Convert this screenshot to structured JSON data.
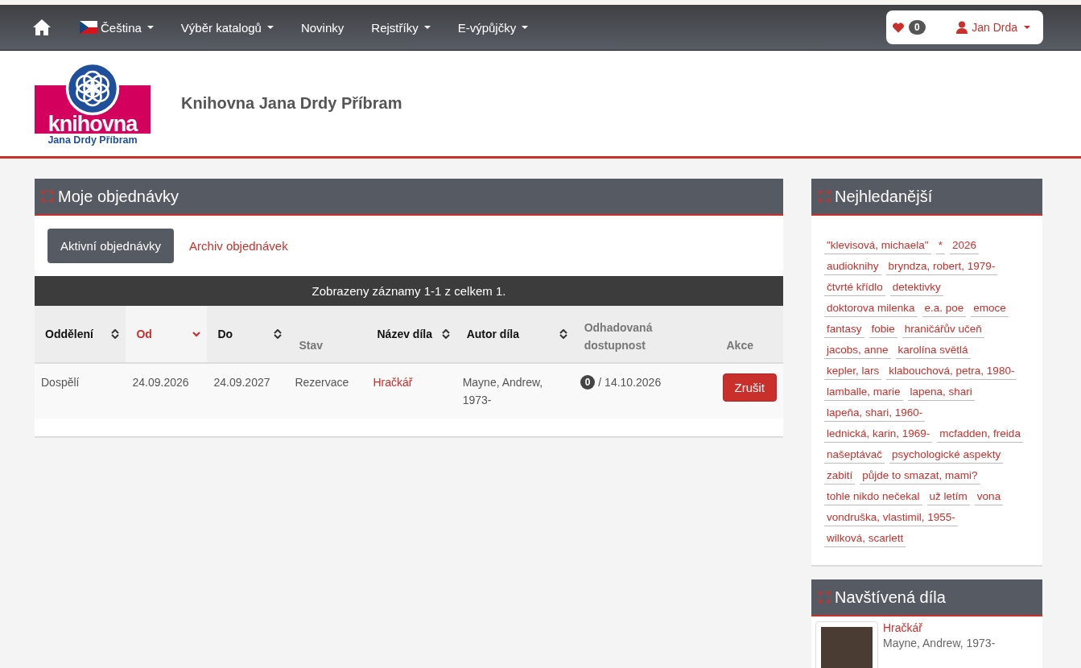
{
  "nav": {
    "items": [
      {
        "label": "Čeština",
        "flag": true,
        "dropdown": true
      },
      {
        "label": "Výběr katalogů",
        "flag": false,
        "dropdown": true
      },
      {
        "label": "Novinky",
        "flag": false,
        "dropdown": false
      },
      {
        "label": "Rejstříky",
        "flag": false,
        "dropdown": true
      },
      {
        "label": "E-výpůjčky",
        "flag": false,
        "dropdown": true
      }
    ],
    "favorites_count": "0",
    "user": "Jan Drda"
  },
  "header": {
    "logo_word": "knihovna",
    "logo_sub": "Jana Drdy Příbram",
    "title": "Knihovna Jana Drdy Příbram"
  },
  "orders": {
    "title": "Moje objednávky",
    "tabs": [
      {
        "label": "Aktivní objednávky",
        "selected": true
      },
      {
        "label": "Archiv objednávek",
        "selected": false
      }
    ],
    "summary": "Zobrazeny záznamy 1-1 z celkem 1.",
    "columns": [
      {
        "label": "Oddělení",
        "sortable": true,
        "selected": false
      },
      {
        "label": "Od",
        "sortable": true,
        "selected": true
      },
      {
        "label": "Do",
        "sortable": true,
        "selected": false
      },
      {
        "label": "Stav",
        "sortable": false,
        "selected": false
      },
      {
        "label": "Název díla",
        "sortable": true,
        "selected": false
      },
      {
        "label": "Autor díla",
        "sortable": true,
        "selected": false
      },
      {
        "label": "Odhadovaná dostupnost",
        "sortable": false,
        "selected": false
      },
      {
        "label": "Akce",
        "sortable": false,
        "selected": false
      }
    ],
    "rows": [
      {
        "department": "Dospělí",
        "from": "24.09.2026",
        "to": "24.09.2027",
        "status": "Rezervace",
        "title": "Hračkář",
        "author": "Mayne, Andrew, 1973-",
        "queue": "0",
        "available": "/ 14.10.2026",
        "action": "Zrušit"
      }
    ]
  },
  "most_searched": {
    "title": "Nejhledanější",
    "tags": [
      "\"klevisová, michaela\"",
      "*",
      "2026",
      "audioknihy",
      "bryndza, robert, 1979-",
      "čtvrté křídlo",
      "detektivky",
      "doktorova milenka",
      "e.a. poe",
      "emoce",
      "fantasy",
      "fobie",
      "hraničářův učeň",
      "jacobs, anne",
      "karolína světlá",
      "kepler, lars",
      "klabouchová, petra, 1980-",
      "lamballe, marie",
      "lapena, shari",
      "lapeňa, shari, 1960-",
      "lednická, karin, 1969-",
      "mcfadden, freida",
      "našeptávač",
      "psychologické aspekty",
      "zabití",
      "půjde to smazat, mami?",
      "tohle nikdo nečekal",
      "už letím",
      "vona",
      "vondruška, vlastimil, 1955-",
      "wilková, scarlett"
    ]
  },
  "visited": {
    "title": "Navštívená díla",
    "items": [
      {
        "title": "Hračkář",
        "author": "Mayne, Andrew, 1973-"
      }
    ]
  }
}
